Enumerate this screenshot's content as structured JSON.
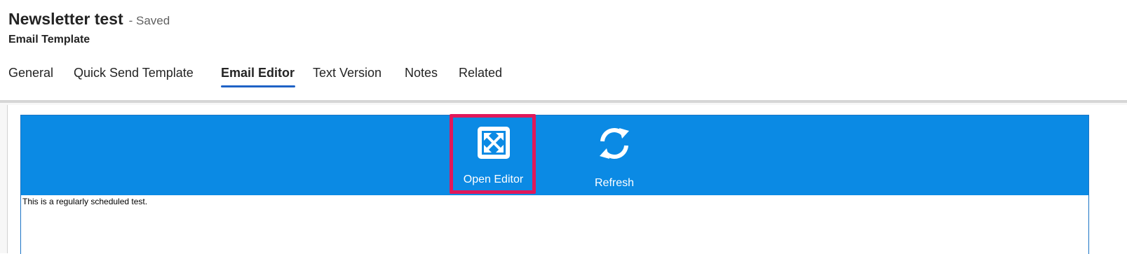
{
  "record": {
    "title": "Newsletter test",
    "status": "- Saved",
    "entity_type": "Email Template"
  },
  "tabs": [
    {
      "label": "General"
    },
    {
      "label": "Quick Send Template"
    },
    {
      "label": "Email Editor",
      "active": true
    },
    {
      "label": "Text Version"
    },
    {
      "label": "Notes"
    },
    {
      "label": "Related"
    }
  ],
  "editor": {
    "toolbar": {
      "open_editor_label": "Open Editor",
      "open_editor_icon": "expand-icon",
      "refresh_label": "Refresh",
      "refresh_icon": "refresh-icon"
    },
    "body_text": "This is a regularly scheduled test."
  },
  "colors": {
    "toolbar_bg": "#0b8ae4",
    "active_tab_underline": "#1f62c6",
    "highlight": "#e0185a"
  }
}
